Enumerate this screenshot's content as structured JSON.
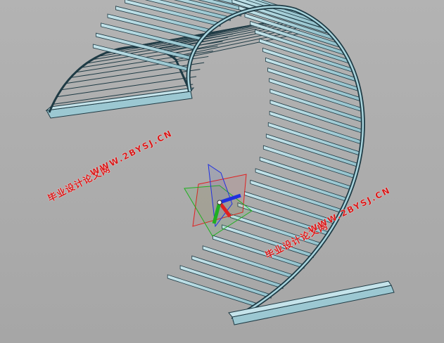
{
  "watermarks": [
    {
      "cn": "毕业设计论文网",
      "url": "WWW.2BYSJ.CN"
    },
    {
      "cn": "毕业设计论文网",
      "url": "WWW.2BYSJ.CN"
    }
  ],
  "model": {
    "fill_color": "#a9d5de",
    "edge_color": "#1e3a44",
    "slat_count": 44
  },
  "triad": {
    "x_color": "#e02020",
    "y_color": "#20b020",
    "z_color": "#2030e0"
  }
}
